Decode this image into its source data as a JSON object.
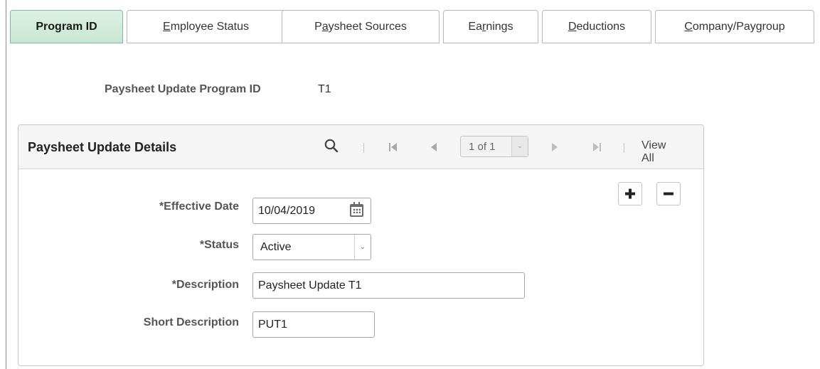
{
  "tabs": [
    {
      "pre": "Program ID",
      "mn": "",
      "post": ""
    },
    {
      "pre": "",
      "mn": "E",
      "post": "mployee Status"
    },
    {
      "pre": "P",
      "mn": "a",
      "post": "ysheet Sources"
    },
    {
      "pre": "Ea",
      "mn": "r",
      "post": "nings"
    },
    {
      "pre": "",
      "mn": "D",
      "post": "eductions"
    },
    {
      "pre": "",
      "mn": "C",
      "post": "ompany/Paygroup"
    }
  ],
  "program": {
    "label": "Paysheet Update Program ID",
    "value": "T1"
  },
  "panel": {
    "title": "Paysheet Update Details",
    "pager_text": "1 of 1",
    "view_all": "View All",
    "icons": {
      "search": "search-icon",
      "first": "first-page-icon",
      "prev": "previous-icon",
      "next": "next-icon",
      "last": "last-page-icon",
      "add": "plus-icon",
      "delete": "minus-icon",
      "calendar": "calendar-icon",
      "dropdown": "chevron-down-icon"
    }
  },
  "form": {
    "effective_date": {
      "label": "*Effective Date",
      "value": "10/04/2019"
    },
    "status": {
      "label": "*Status",
      "value": "Active"
    },
    "description": {
      "label": "*Description",
      "value": "Paysheet Update T1"
    },
    "short_description": {
      "label": "Short Description",
      "value": "PUT1"
    }
  },
  "colors": {
    "active_tab": "#cfead9",
    "panel_header": "#f5f5f5",
    "icon_gray": "#9a9a9a"
  }
}
